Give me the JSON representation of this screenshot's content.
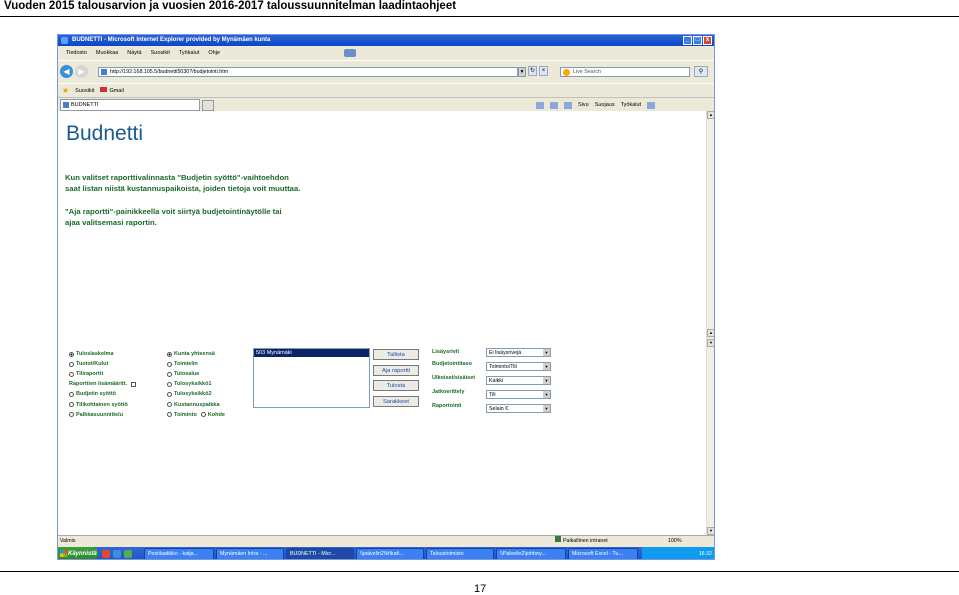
{
  "slide": {
    "title": "Vuoden 2015 talousarvion ja vuosien 2016-2017 taloussuunnitelman laadintaohjeet",
    "page_number": "17"
  },
  "window": {
    "title": "BUDNETTI - Microsoft Internet Explorer provided by Mynämäen kunta",
    "controls": [
      "_",
      "□",
      "x"
    ]
  },
  "menu": [
    "Tiedosto",
    "Muokkaa",
    "Näytä",
    "Suosikit",
    "Työkalut",
    "Ohje"
  ],
  "address": {
    "url": "http://192.168.105.5/budnetti5030?/budjetointi.htm",
    "search_placeholder": "Live Search"
  },
  "favorites": {
    "label": "Suosikit",
    "items": [
      "Gmail"
    ]
  },
  "tab": {
    "label": "BUDNETTI"
  },
  "command_bar": [
    "Sivu",
    "Suojaus",
    "Työkalut"
  ],
  "page": {
    "brand": "Budnetti",
    "para1_line1": "Kun valitset raporttivalinnasta \"Budjetin syöttö\"-vaihtoehdon",
    "para1_line2": "saat listan niistä kustannuspaikoista, joiden tietoja voit muuttaa.",
    "para2_line1": "\"Aja raportti\"-painikkeella voit siirtyä budjetointinäytölle tai",
    "para2_line2": "ajaa valitsemasi raportin."
  },
  "report_options": {
    "col1": [
      {
        "label": "Tuloslaskelma",
        "selected": true
      },
      {
        "label": "Tuotot/Kulut",
        "selected": false
      },
      {
        "label": "Tiliraportti",
        "selected": false
      },
      {
        "label": "Raporttien lisämääritt.",
        "checkbox": true
      },
      {
        "label": "Budjetin syöttö",
        "selected": false
      },
      {
        "label": "Tilikohtainen syöttö",
        "selected": false
      },
      {
        "label": "Palkkasuunnittelu",
        "selected": false
      }
    ],
    "col2": [
      {
        "label": "Kunta yhteensä",
        "selected": true
      },
      {
        "label": "Toimielin",
        "selected": false
      },
      {
        "label": "Tulosalue",
        "selected": false
      },
      {
        "label": "Tulosyksikkö1",
        "selected": false
      },
      {
        "label": "Tulosyksikkö2",
        "selected": false
      },
      {
        "label": "Kustannuspaikka",
        "selected": false
      },
      {
        "label": "Toiminto",
        "selected": false,
        "extra": "Kohde"
      }
    ]
  },
  "listbox": {
    "selected": "503 Mynämäki"
  },
  "buttons": [
    "Tallista",
    "Aja raportti",
    "Tulosta",
    "Sarakkeet"
  ],
  "settings": [
    {
      "label": "Lisäysrivit",
      "value": "Ei lisäysrivejä"
    },
    {
      "label": "Budjetointitaso",
      "value": "Toiminto/Tili"
    },
    {
      "label": "Ulkoiset/sisäiset",
      "value": "Kaikki"
    },
    {
      "label": "Jatkoerittely",
      "value": "Tili"
    },
    {
      "label": "Raportointi",
      "value": "Selain €"
    }
  ],
  "status": {
    "left": "Valmis",
    "zone": "Paikallinen intranet",
    "zoom": "100%"
  },
  "taskbar": {
    "start": "Käynnistä",
    "tasks": [
      "Postilaatikko - katja...",
      "Mynämäen Intra - ...",
      "BUDNETTI - Micr...",
      "\\\\palvelin2\\kt\\kat\\...",
      "Taloustoimisto",
      "\\\\Palvelin2\\johtory...",
      "Microsoft Excel - Tu..."
    ],
    "clock": "16:32"
  }
}
